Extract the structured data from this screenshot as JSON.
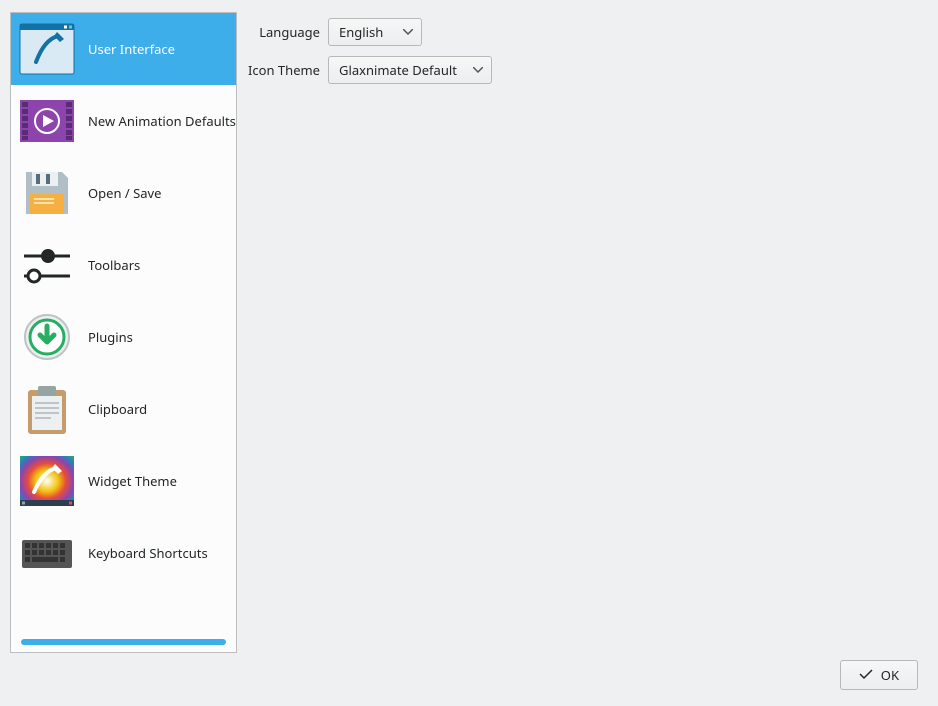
{
  "sidebar": {
    "items": [
      {
        "label": "User Interface",
        "selected": true
      },
      {
        "label": "New Animation Defaults",
        "selected": false
      },
      {
        "label": "Open / Save",
        "selected": false
      },
      {
        "label": "Toolbars",
        "selected": false
      },
      {
        "label": "Plugins",
        "selected": false
      },
      {
        "label": "Clipboard",
        "selected": false
      },
      {
        "label": "Widget Theme",
        "selected": false
      },
      {
        "label": "Keyboard Shortcuts",
        "selected": false
      }
    ]
  },
  "form": {
    "language_label": "Language",
    "language_value": "English",
    "icon_theme_label": "Icon Theme",
    "icon_theme_value": "Glaxnimate Default"
  },
  "buttons": {
    "ok": "OK"
  }
}
